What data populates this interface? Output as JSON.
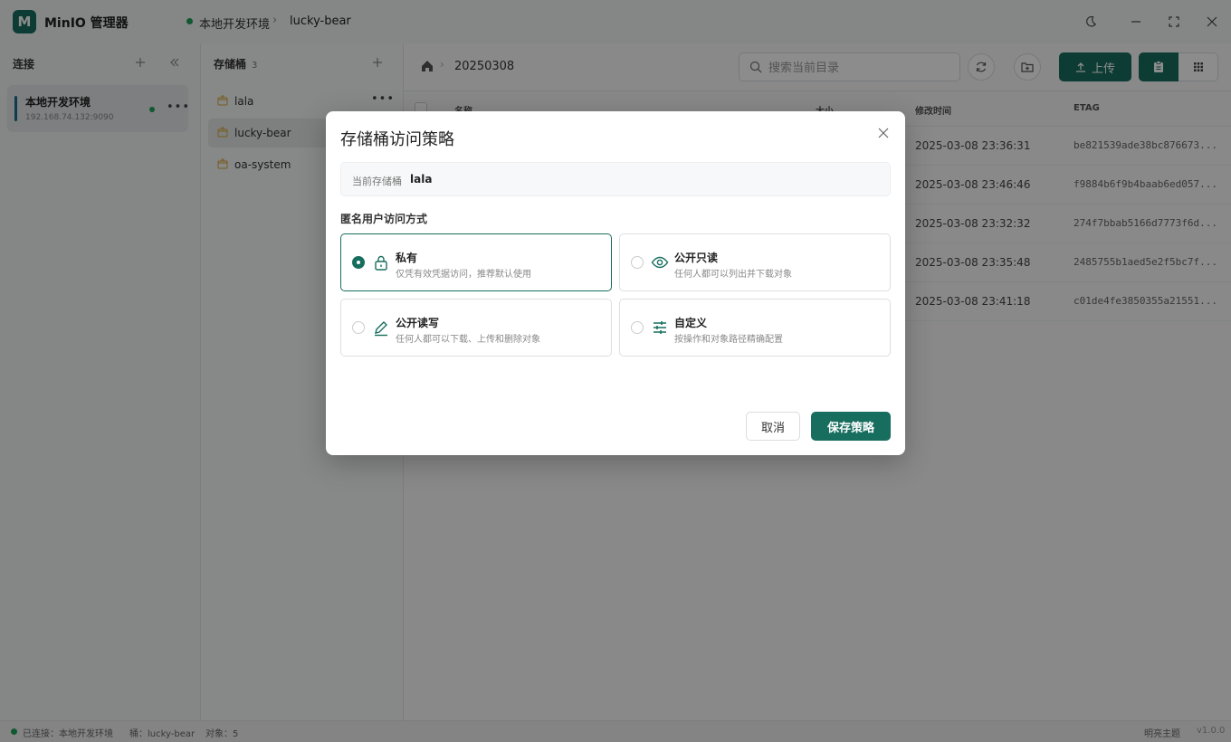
{
  "app": {
    "logo_letter": "M",
    "title": "MinIO 管理器",
    "breadcrumb_connection": "本地开发环境",
    "breadcrumb_separator": "›",
    "breadcrumb_bucket": "lucky-bear"
  },
  "colors": {
    "accent": "#176e5f",
    "online": "#1fa05a"
  },
  "connections": {
    "header": "连接",
    "items": [
      {
        "name": "本地开发环境",
        "host": "192.168.74.132:9090",
        "status": "online"
      }
    ]
  },
  "buckets": {
    "header": "存储桶",
    "count": "3",
    "items": [
      {
        "name": "lala"
      },
      {
        "name": "lucky-bear",
        "active": true
      },
      {
        "name": "oa-system"
      }
    ]
  },
  "browser": {
    "path": "20250308",
    "search_placeholder": "搜索当前目录",
    "upload_label": "上传",
    "columns": [
      "名称",
      "大小",
      "修改时间",
      "ETAG"
    ],
    "rows": [
      {
        "modified": "2025-03-08 23:36:31",
        "etag": "be821539ade38bc876673..."
      },
      {
        "modified": "2025-03-08 23:46:46",
        "etag": "f9884b6f9b4baab6ed057..."
      },
      {
        "modified": "2025-03-08 23:32:32",
        "etag": "274f7bbab5166d7773f6d..."
      },
      {
        "modified": "2025-03-08 23:35:48",
        "etag": "2485755b1aed5e2f5bc7f..."
      },
      {
        "modified": "2025-03-08 23:41:18",
        "etag": "c01de4fe3850355a21551..."
      }
    ]
  },
  "statusbar": {
    "connected": "已连接：本地开发环境",
    "bucket": "桶：lucky-bear",
    "objects": "对象：5",
    "theme": "明亮主题",
    "version": "v1.0.0"
  },
  "dialog": {
    "title": "存储桶访问策略",
    "current_label": "当前存储桶",
    "current_value": "lala",
    "access_label": "匿名用户访问方式",
    "options": [
      {
        "title": "私有",
        "desc": "仅凭有效凭据访问，推荐默认使用",
        "icon": "lock-icon",
        "selected": true
      },
      {
        "title": "公开只读",
        "desc": "任何人都可以列出并下载对象",
        "icon": "eye-icon",
        "selected": false
      },
      {
        "title": "公开读写",
        "desc": "任何人都可以下载、上传和删除对象",
        "icon": "pencil-icon",
        "selected": false
      },
      {
        "title": "自定义",
        "desc": "按操作和对象路径精确配置",
        "icon": "sliders-icon",
        "selected": false
      }
    ],
    "cancel_label": "取消",
    "save_label": "保存策略"
  }
}
